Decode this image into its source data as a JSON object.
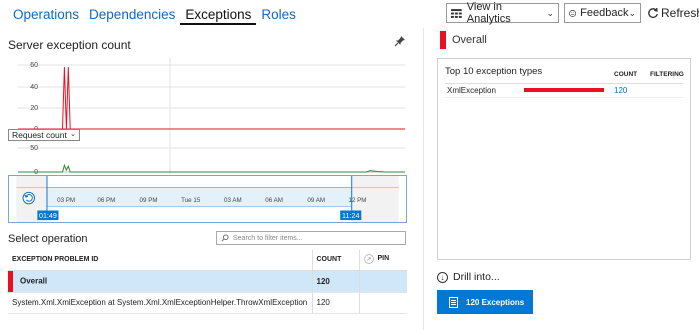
{
  "tabs": [
    {
      "label": "Operations"
    },
    {
      "label": "Dependencies"
    },
    {
      "label": "Exceptions",
      "active": true
    },
    {
      "label": "Roles"
    }
  ],
  "toolbar": {
    "analytics_label": "View in Analytics",
    "feedback_label": "Feedback",
    "refresh_label": "Refresh"
  },
  "left": {
    "title": "Server exception count",
    "metric_select": "Request count",
    "select_operation_title": "Select operation",
    "filter_placeholder": "Search to filter items...",
    "table": {
      "headers": {
        "id": "EXCEPTION PROBLEM ID",
        "count": "COUNT",
        "pin": "PIN"
      },
      "rows": [
        {
          "id": "Overall",
          "count": "120",
          "selected": true
        },
        {
          "id": "System.Xml.XmlException at System.Xml.XmlExceptionHelper.ThrowXmlException",
          "count": "120",
          "selected": false
        }
      ]
    }
  },
  "chart_data": [
    {
      "type": "line",
      "title": "Server exception count",
      "y_ticks": [
        0,
        20,
        40,
        60
      ],
      "ylim": [
        0,
        70
      ],
      "series": [
        {
          "color": "#e81123",
          "points": [
            [
              0.115,
              0
            ],
            [
              0.12,
              58
            ],
            [
              0.125,
              0
            ],
            [
              0.13,
              58
            ],
            [
              0.135,
              0
            ]
          ]
        }
      ],
      "grid": true
    },
    {
      "type": "line",
      "title": "Request count",
      "y_ticks": [
        0,
        50
      ],
      "ylim": [
        0,
        60
      ],
      "x_ticks": [
        "03 PM",
        "06 PM",
        "09 PM",
        "Tue 15",
        "03 AM",
        "06 AM",
        "09 AM"
      ],
      "series": [
        {
          "color": "#2e8b30",
          "points": [
            [
              0.115,
              0
            ],
            [
              0.12,
              14
            ],
            [
              0.125,
              4
            ],
            [
              0.13,
              12
            ],
            [
              0.135,
              0
            ],
            [
              0.9,
              0
            ],
            [
              0.91,
              3
            ],
            [
              0.93,
              1
            ],
            [
              0.95,
              0
            ]
          ]
        }
      ]
    }
  ],
  "timeline": {
    "x_ticks": [
      "03 PM",
      "06 PM",
      "09 PM",
      "Tue 15",
      "03 AM",
      "06 AM",
      "09 AM",
      "12 PM"
    ],
    "start_label": "01:49",
    "end_label": "11:24"
  },
  "right": {
    "header": "Overall",
    "card_title": "Top 10 exception types",
    "col_count": "COUNT",
    "col_filtering": "FILTERING",
    "rows": [
      {
        "name": "XmlException",
        "count": "120"
      }
    ],
    "drill_label": "Drill into...",
    "button_label": "120 Exceptions"
  },
  "colors": {
    "accent": "#0078d4",
    "link": "#0e6ac4",
    "error": "#e81123",
    "requests": "#2e8b30"
  }
}
